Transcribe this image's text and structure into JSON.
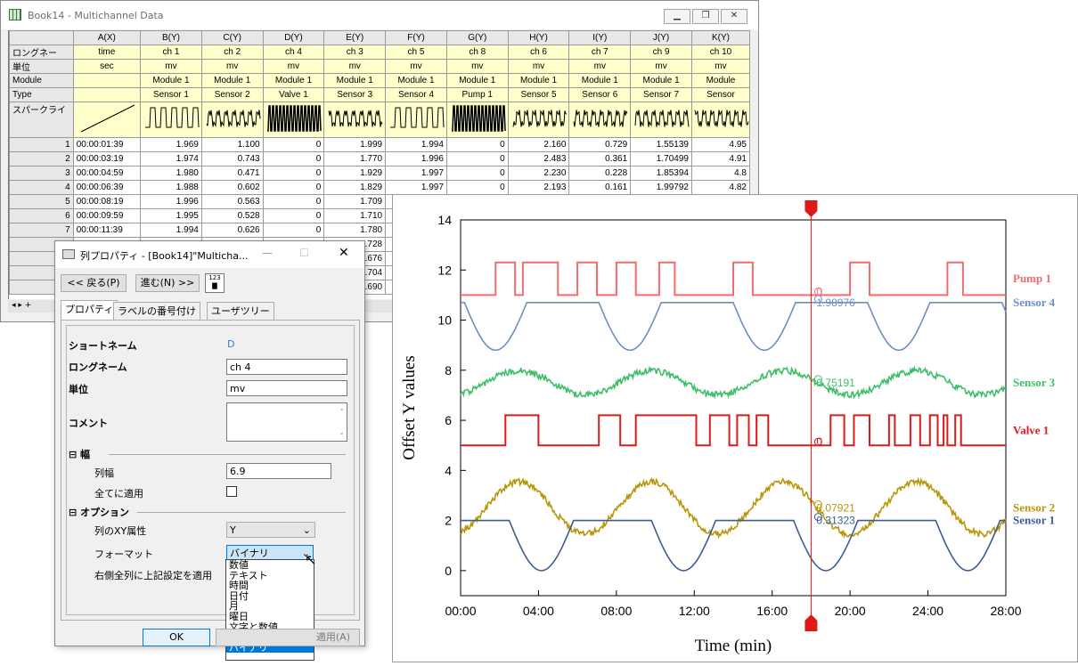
{
  "workbook": {
    "title": "Book14 - Multichannel Data",
    "controls": [
      "▁",
      "❐",
      "✕"
    ],
    "columns": [
      "A(X)",
      "B(Y)",
      "C(Y)",
      "D(Y)",
      "E(Y)",
      "F(Y)",
      "G(Y)",
      "H(Y)",
      "I(Y)",
      "J(Y)",
      "K(Y)"
    ],
    "row_labels": {
      "longname": "ロングネー",
      "unit": "単位",
      "module": "Module",
      "type": "Type",
      "sparkline": "スパークライ"
    },
    "longnames": [
      "time",
      "ch 1",
      "ch 2",
      "ch 4",
      "ch 3",
      "ch 5",
      "ch 8",
      "ch 6",
      "ch 7",
      "ch 9",
      "ch 10"
    ],
    "units": [
      "sec",
      "mv",
      "mv",
      "mv",
      "mv",
      "mv",
      "mv",
      "mv",
      "mv",
      "mv",
      "mv"
    ],
    "modules": [
      "",
      "Module 1",
      "Module 1",
      "Module 1",
      "Module 1",
      "Module 1",
      "Module 1",
      "Module 1",
      "Module 1",
      "Module 1",
      "Module"
    ],
    "types": [
      "",
      "Sensor 1",
      "Sensor 2",
      "Valve 1",
      "Sensor 3",
      "Sensor 4",
      "Pump 1",
      "Sensor 5",
      "Sensor 6",
      "Sensor 7",
      "Sensor"
    ],
    "rows": [
      [
        "1",
        "00:00:01:39",
        "1.969",
        "1.100",
        "0",
        "1.999",
        "1.994",
        "0",
        "2.160",
        "0.729",
        "1.55139",
        "4.95"
      ],
      [
        "2",
        "00:00:03:19",
        "1.974",
        "0.743",
        "0",
        "1.770",
        "1.996",
        "0",
        "2.483",
        "0.361",
        "1.70499",
        "4.91"
      ],
      [
        "3",
        "00:00:04:59",
        "1.980",
        "0.471",
        "0",
        "1.929",
        "1.997",
        "0",
        "2.230",
        "0.228",
        "1.85394",
        "4.8"
      ],
      [
        "4",
        "00:00:06:39",
        "1.988",
        "0.602",
        "0",
        "1.829",
        "1.997",
        "0",
        "2.193",
        "0.161",
        "1.99792",
        "4.82"
      ],
      [
        "5",
        "00:00:08:19",
        "1.996",
        "0.563",
        "0",
        "1.709",
        "",
        "",
        "",
        "",
        "",
        ""
      ],
      [
        "6",
        "00:00:09:59",
        "1.995",
        "0.528",
        "0",
        "1.710",
        "",
        "",
        "",
        "",
        "",
        ""
      ],
      [
        "7",
        "00:00:11:39",
        "1.994",
        "0.626",
        "0",
        "1.780",
        "",
        "",
        "",
        "",
        "",
        ""
      ],
      [
        "",
        "",
        "",
        "",
        "",
        "1.728",
        "",
        "",
        "",
        "",
        "",
        ""
      ],
      [
        "",
        "",
        "",
        "",
        "",
        "1.676",
        "",
        "",
        "",
        "",
        "",
        ""
      ],
      [
        "",
        "",
        "",
        "",
        "",
        "1.704",
        "",
        "",
        "",
        "",
        "",
        ""
      ],
      [
        "",
        "",
        "",
        "",
        "",
        "1.690",
        "",
        "",
        "",
        "",
        "",
        ""
      ]
    ]
  },
  "dialog": {
    "title": "列プロパティ - [Book14]\"Multicha...",
    "back_label": "<< 戻る(P)",
    "next_label": "進む(N) >>",
    "tabs": [
      "プロパティ",
      "ラベルの番号付け",
      "ユーザツリー"
    ],
    "short_name_label": "ショートネーム",
    "short_name_value": "D",
    "long_name_label": "ロングネーム",
    "long_name_value": "ch 4",
    "unit_label": "単位",
    "unit_value": "mv",
    "comment_label": "コメント",
    "width_section": "幅",
    "col_width_label": "列幅",
    "col_width_value": "6.9",
    "apply_all_label": "全てに適用",
    "options_section": "オプション",
    "xy_attr_label": "列のXY属性",
    "xy_attr_value": "Y",
    "format_label": "フォーマット",
    "format_value": "バイナリ",
    "apply_right_label": "右側全列に上記設定を適用",
    "format_options": [
      "数値",
      "テキスト",
      "時間",
      "日付",
      "月",
      "曜日",
      "文字と数値",
      "色",
      "バイナリ"
    ],
    "ok_label": "OK",
    "apply_label": "適用(A)"
  },
  "chart_data": {
    "type": "line",
    "xlabel": "Time (min)",
    "ylabel": "Offset Y values",
    "xticks": [
      "00:00",
      "04:00",
      "08:00",
      "12:00",
      "16:00",
      "20:00",
      "24:00",
      "28:00"
    ],
    "xlim": [
      0,
      28
    ],
    "ylim": [
      -1,
      14
    ],
    "yticks": [
      0,
      2,
      4,
      6,
      8,
      10,
      12,
      14
    ],
    "cursor_x": 18,
    "series": [
      {
        "name": "Pump 1",
        "color": "#f26c6c",
        "offset": 11,
        "kind": "step",
        "high_intervals": [
          [
            1.8,
            2.8
          ],
          [
            3.2,
            5.0
          ],
          [
            6.0,
            7.0
          ],
          [
            8.0,
            9.0
          ],
          [
            10.2,
            11.0
          ],
          [
            14.0,
            15.0
          ],
          [
            20.0,
            21.0
          ],
          [
            25.0,
            25.8
          ]
        ],
        "amp": 1.3,
        "cursor_value": "0"
      },
      {
        "name": "Sensor 4",
        "color": "#6b8fc2",
        "offset": 10.7,
        "kind": "wave",
        "amp": 1.9,
        "cursor_value": "1.98976"
      },
      {
        "name": "Sensor 3",
        "color": "#3fbf6a",
        "offset": 7.5,
        "kind": "noise",
        "amp": 0.6,
        "cursor_value": "0.75191"
      },
      {
        "name": "Valve 1",
        "color": "#e01818",
        "offset": 5,
        "kind": "step",
        "high_intervals": [
          [
            2.3,
            4.0
          ],
          [
            7.1,
            8.2
          ],
          [
            9.0,
            12.1
          ],
          [
            12.8,
            13.8
          ],
          [
            14.2,
            14.8
          ],
          [
            15.2,
            15.8
          ],
          [
            19.0,
            19.7
          ],
          [
            20.2,
            21.0
          ],
          [
            22.0,
            22.3
          ],
          [
            23.1,
            23.6
          ],
          [
            24.1,
            24.5
          ],
          [
            24.8,
            25.0
          ],
          [
            25.4,
            25.7
          ]
        ],
        "amp": 1.2,
        "cursor_value": "0"
      },
      {
        "name": "Sensor 2",
        "color": "#b8960a",
        "offset": 2.5,
        "kind": "noise",
        "amp": 1.3,
        "cursor_value": "0.07921"
      },
      {
        "name": "Sensor 1",
        "color": "#3a5f8f",
        "offset": 2,
        "kind": "wave",
        "amp": 2.0,
        "cursor_value": "0.31323"
      }
    ]
  }
}
